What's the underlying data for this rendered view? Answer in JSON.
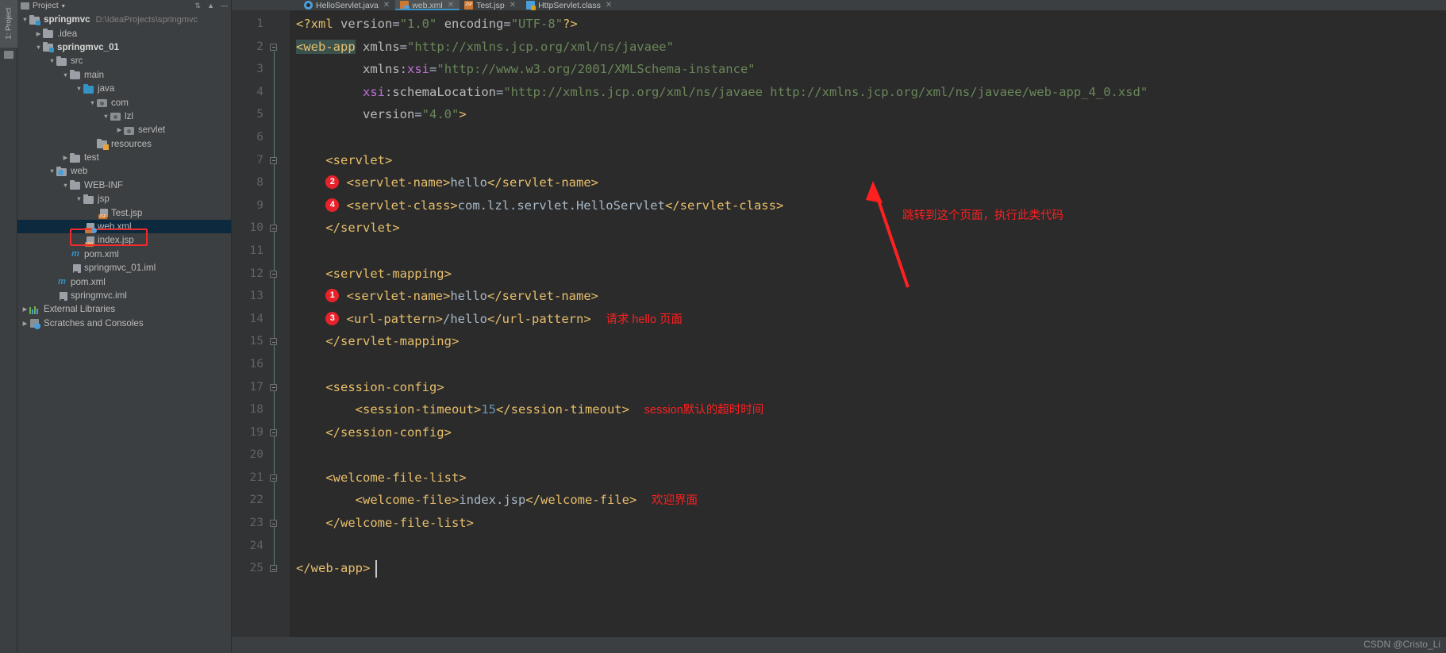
{
  "window": {
    "tool_strip_label": "1: Project",
    "project_panel_title": "Project",
    "watermark": "CSDN @Cristo_Li"
  },
  "project_tree": [
    {
      "depth": 0,
      "arrow": "down",
      "icon": "module-folder-icon",
      "label": "springmvc",
      "bold": true,
      "sub": "D:\\IdeaProjects\\springmvc"
    },
    {
      "depth": 1,
      "arrow": "right",
      "icon": "folder-icon",
      "label": ".idea",
      "bold": false,
      "sub": ""
    },
    {
      "depth": 1,
      "arrow": "down",
      "icon": "module-folder-icon",
      "label": "springmvc_01",
      "bold": true,
      "sub": ""
    },
    {
      "depth": 2,
      "arrow": "down",
      "icon": "folder-icon",
      "label": "src",
      "bold": false,
      "sub": ""
    },
    {
      "depth": 3,
      "arrow": "down",
      "icon": "folder-icon",
      "label": "main",
      "bold": false,
      "sub": ""
    },
    {
      "depth": 4,
      "arrow": "down",
      "icon": "source-folder-icon",
      "label": "java",
      "bold": false,
      "sub": ""
    },
    {
      "depth": 5,
      "arrow": "down",
      "icon": "package-icon",
      "label": "com",
      "bold": false,
      "sub": ""
    },
    {
      "depth": 6,
      "arrow": "down",
      "icon": "package-icon",
      "label": "lzl",
      "bold": false,
      "sub": ""
    },
    {
      "depth": 7,
      "arrow": "right",
      "icon": "package-icon",
      "label": "servlet",
      "bold": false,
      "sub": ""
    },
    {
      "depth": 5,
      "arrow": "none",
      "icon": "resources-folder-icon",
      "label": "resources",
      "bold": false,
      "sub": ""
    },
    {
      "depth": 3,
      "arrow": "right",
      "icon": "folder-icon",
      "label": "test",
      "bold": false,
      "sub": ""
    },
    {
      "depth": 2,
      "arrow": "down",
      "icon": "web-folder-icon",
      "label": "web",
      "bold": false,
      "sub": ""
    },
    {
      "depth": 3,
      "arrow": "down",
      "icon": "folder-icon",
      "label": "WEB-INF",
      "bold": false,
      "sub": ""
    },
    {
      "depth": 4,
      "arrow": "down",
      "icon": "folder-icon",
      "label": "jsp",
      "bold": false,
      "sub": ""
    },
    {
      "depth": 5,
      "arrow": "none",
      "icon": "jsp-file-icon",
      "label": "Test.jsp",
      "bold": false,
      "sub": ""
    },
    {
      "depth": 4,
      "arrow": "none",
      "icon": "xml-file-icon",
      "label": "web.xml",
      "bold": false,
      "sub": "",
      "selected": true,
      "highlight_box": true
    },
    {
      "depth": 4,
      "arrow": "none",
      "icon": "jsp-file-icon",
      "label": "index.jsp",
      "bold": false,
      "sub": ""
    },
    {
      "depth": 3,
      "arrow": "none",
      "icon": "maven-icon",
      "label": "pom.xml",
      "bold": false,
      "sub": ""
    },
    {
      "depth": 3,
      "arrow": "none",
      "icon": "iml-file-icon",
      "label": "springmvc_01.iml",
      "bold": false,
      "sub": ""
    },
    {
      "depth": 2,
      "arrow": "none",
      "icon": "maven-icon",
      "label": "pom.xml",
      "bold": false,
      "sub": ""
    },
    {
      "depth": 2,
      "arrow": "none",
      "icon": "iml-file-icon",
      "label": "springmvc.iml",
      "bold": false,
      "sub": ""
    },
    {
      "depth": 0,
      "arrow": "right",
      "icon": "external-libraries-icon",
      "label": "External Libraries",
      "bold": false,
      "sub": ""
    },
    {
      "depth": 0,
      "arrow": "right",
      "icon": "scratches-icon",
      "label": "Scratches and Consoles",
      "bold": false,
      "sub": ""
    }
  ],
  "editor_tabs": [
    {
      "label": "HelloServlet.java",
      "icon": "java-class-icon",
      "active": false
    },
    {
      "label": "web.xml",
      "icon": "xml-file-icon",
      "active": true
    },
    {
      "label": "Test.jsp",
      "icon": "jsp-file-icon",
      "active": false
    },
    {
      "label": "HttpServlet.class",
      "icon": "class-file-icon",
      "active": false
    }
  ],
  "code_lines": [
    {
      "n": 1,
      "text": "<?xml version=\"1.0\" encoding=\"UTF-8\"?>"
    },
    {
      "n": 2,
      "text": "<web-app xmlns=\"http://xmlns.jcp.org/xml/ns/javaee\""
    },
    {
      "n": 3,
      "text": "         xmlns:xsi=\"http://www.w3.org/2001/XMLSchema-instance\""
    },
    {
      "n": 4,
      "text": "         xsi:schemaLocation=\"http://xmlns.jcp.org/xml/ns/javaee http://xmlns.jcp.org/xml/ns/javaee/web-app_4_0.xsd\""
    },
    {
      "n": 5,
      "text": "         version=\"4.0\">"
    },
    {
      "n": 6,
      "text": ""
    },
    {
      "n": 7,
      "text": "    <servlet>"
    },
    {
      "n": 8,
      "text": "      <servlet-name>hello</servlet-name>",
      "badge": "2"
    },
    {
      "n": 9,
      "text": "      <servlet-class>com.lzl.servlet.HelloServlet</servlet-class>",
      "badge": "4"
    },
    {
      "n": 10,
      "text": "    </servlet>"
    },
    {
      "n": 11,
      "text": ""
    },
    {
      "n": 12,
      "text": "    <servlet-mapping>"
    },
    {
      "n": 13,
      "text": "      <servlet-name>hello</servlet-name>",
      "badge": "1"
    },
    {
      "n": 14,
      "text": "      <url-pattern>/hello</url-pattern>",
      "badge": "3",
      "note": "请求 hello 页面"
    },
    {
      "n": 15,
      "text": "    </servlet-mapping>"
    },
    {
      "n": 16,
      "text": ""
    },
    {
      "n": 17,
      "text": "    <session-config>"
    },
    {
      "n": 18,
      "text": "        <session-timeout>15</session-timeout>",
      "note": "session默认的超时时间"
    },
    {
      "n": 19,
      "text": "    </session-config>"
    },
    {
      "n": 20,
      "text": ""
    },
    {
      "n": 21,
      "text": "    <welcome-file-list>"
    },
    {
      "n": 22,
      "text": "        <welcome-file>index.jsp</welcome-file>",
      "note": "欢迎界面"
    },
    {
      "n": 23,
      "text": "    </welcome-file-list>"
    },
    {
      "n": 24,
      "text": ""
    },
    {
      "n": 25,
      "text": "</web-app>"
    }
  ],
  "annotations": {
    "arrow_note": "跳转到这个页面，执行此类代码",
    "arrow_color": "#ff2020"
  },
  "colors": {
    "accent": "#3592c4",
    "badge_red": "#e8222b",
    "note_red": "#ff1f1f",
    "editor_bg": "#2b2b2b",
    "panel_bg": "#3c3f41",
    "selection_blue": "#0d293e"
  }
}
